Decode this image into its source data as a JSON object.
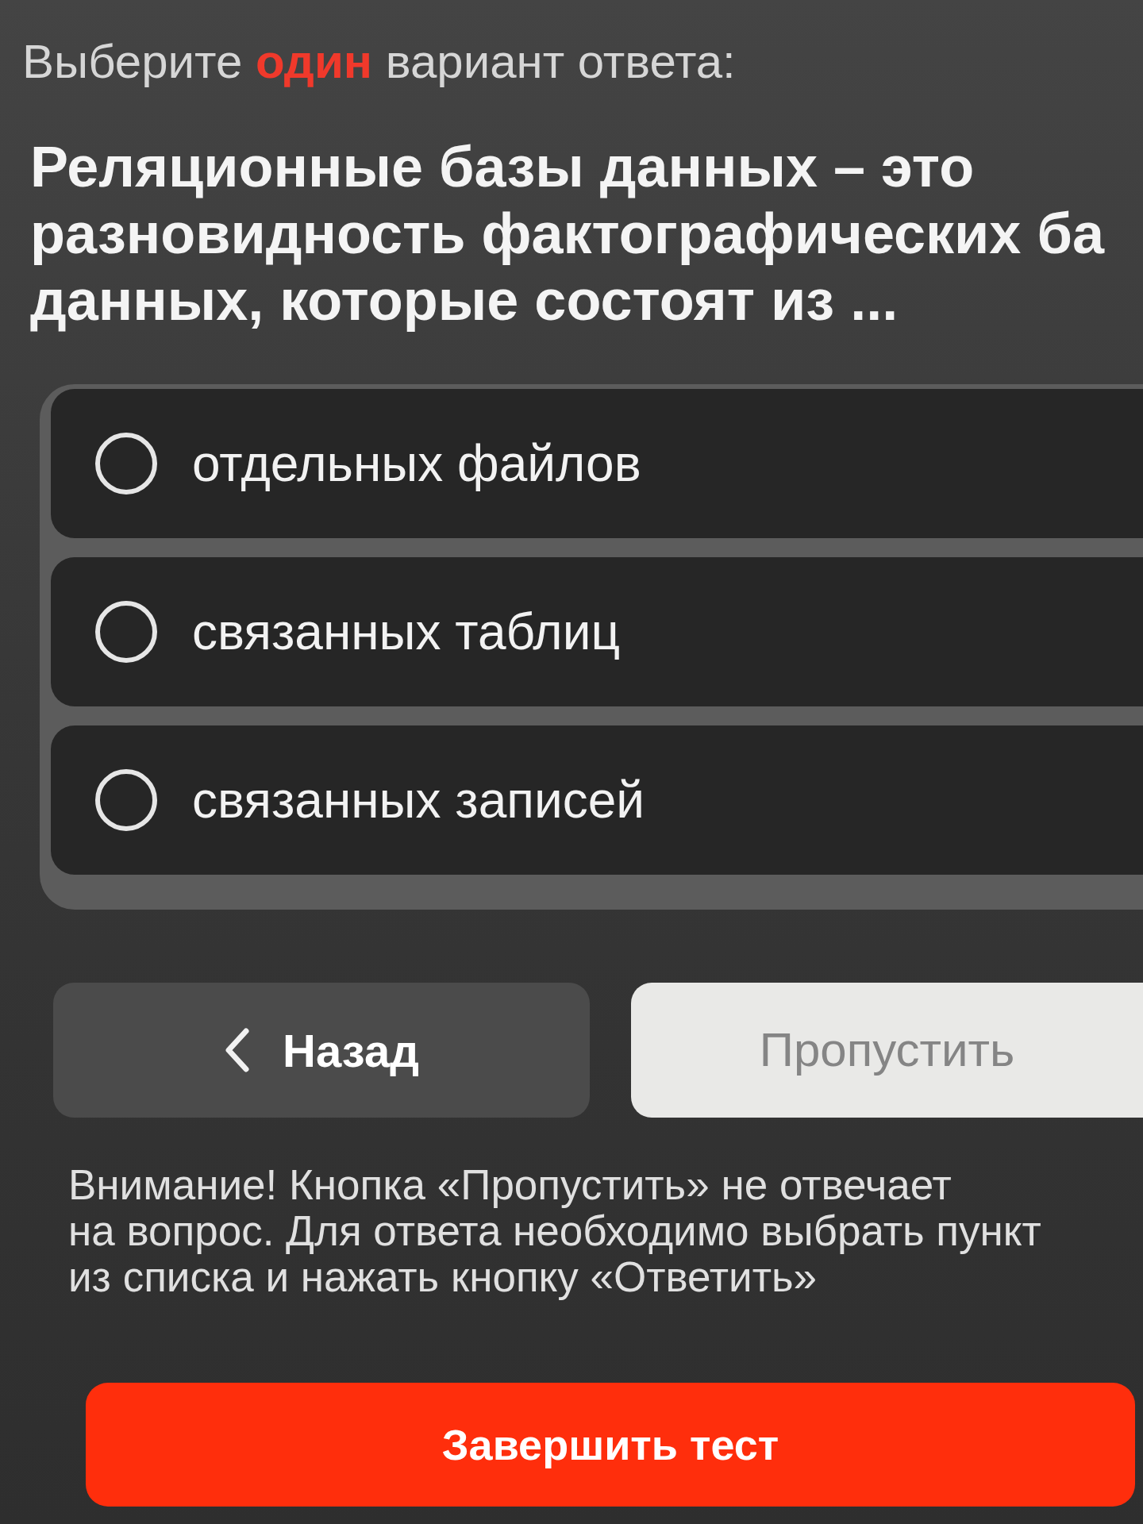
{
  "instruction": "Выберите **один** вариант ответа:",
  "question": {
    "lines": [
      "Реляционные базы данных – это",
      "разновидность фактографических ба",
      "данных, которые состоят из ..."
    ]
  },
  "options": [
    {
      "label": "отдельных файлов",
      "selected": false
    },
    {
      "label": "связанных таблиц",
      "selected": false
    },
    {
      "label": "связанных записей",
      "selected": false
    }
  ],
  "navigation": {
    "back": {
      "label": "Назад"
    },
    "skip": {
      "label": "Пропустить"
    }
  },
  "notice": {
    "lines": [
      "Внимание! Кнопка «Пропустить» не отвечает",
      "на вопрос. Для ответа необходимо выбрать пункт",
      "из списка и нажать кнопку «Ответить»"
    ]
  },
  "finish_button": {
    "label": "Завершить тест"
  }
}
